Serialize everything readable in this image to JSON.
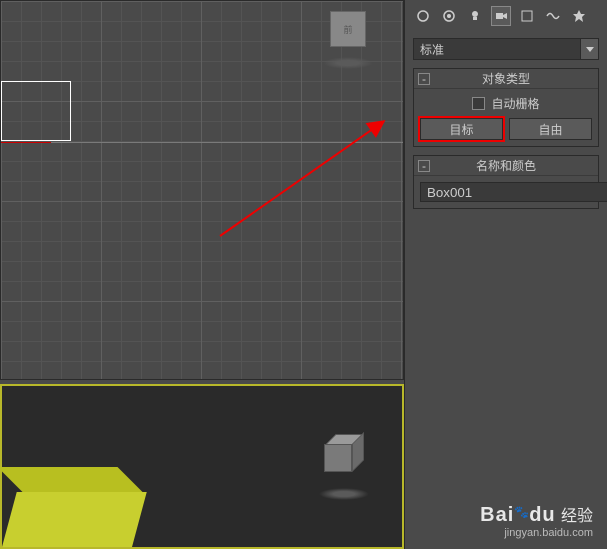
{
  "panel": {
    "dropdown_value": "标准",
    "object_type": {
      "title": "对象类型",
      "toggle": "-",
      "auto_grid_label": "自动栅格",
      "target_btn": "目标",
      "free_btn": "自由"
    },
    "name_color": {
      "title": "名称和颜色",
      "toggle": "-",
      "name_value": "Box001",
      "color": "#c8cf2f"
    }
  },
  "viewcube": {
    "top_face": "前"
  },
  "watermark": {
    "brand_left": "Bai",
    "brand_right": "du",
    "cn": "经验",
    "url": "jingyan.baidu.com"
  }
}
